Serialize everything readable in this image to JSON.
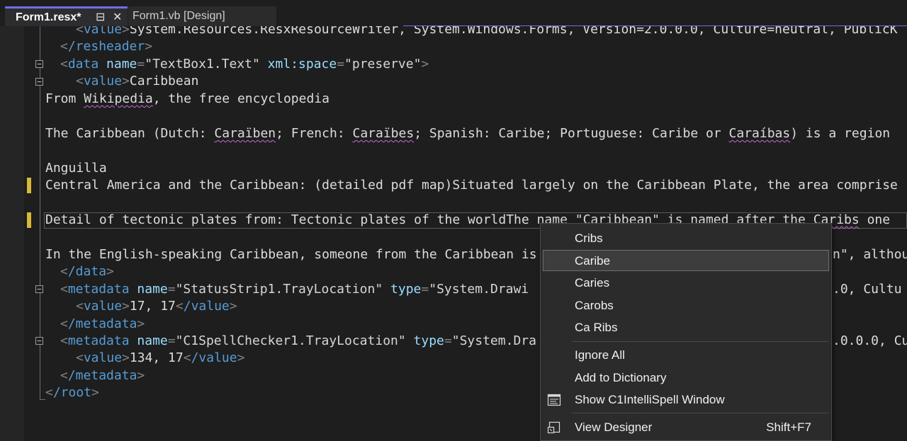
{
  "tabs": [
    {
      "label": "Form1.resx*",
      "active": true
    },
    {
      "label": "Form1.vb [Design]",
      "active": false
    }
  ],
  "tab_icons": {
    "pin": "⊟",
    "close": "✕"
  },
  "colors": {
    "accent": "#6f6fe8",
    "tag": "#569cd6",
    "attribute": "#9cdcfe",
    "change_marker": "#d7ba35"
  },
  "code": {
    "l0": {
      "value_tag": "value",
      "text": "System.Resources.ResxResourceWriter, System.Windows.Forms, Version=2.0.0.0, Culture=neutral, PublicK"
    },
    "l1": {
      "tag": "/resheader"
    },
    "l2": {
      "tag": "data",
      "attr_name": "name",
      "name_val": "\"TextBox1.Text\"",
      "attr_space": "xml:space",
      "space_val": "\"preserve\""
    },
    "l3": {
      "tag": "value",
      "text": "Caribbean"
    },
    "l4": {
      "pre": "From ",
      "squig": "Wikipedia",
      "post": ", the free encyclopedia"
    },
    "l6": {
      "p1": "The Caribbean (Dutch: ",
      "s1": "Caraïben",
      "p2": "; French: ",
      "s2": "Caraïbes",
      "p3": "; Spanish: Caribe; Portuguese: Caribe or ",
      "s3": "Caraíbas",
      "p4": ") is a region"
    },
    "l8": {
      "text": "Anguilla"
    },
    "l9": {
      "text": "Central America and the Caribbean: (detailed pdf map)Situated largely on the Caribbean Plate, the area comprise"
    },
    "l11": {
      "pre": "Detail of tectonic plates from: Tectonic plates of the worldThe name \"Caribbean\" is named after the ",
      "squig": "Caribs",
      "post": " one"
    },
    "l13": {
      "pre": "In the English-speaking Caribbean, someone from the Caribbean is",
      "post": "n\", althou"
    },
    "l14": {
      "tag": "/data"
    },
    "l15": {
      "tag": "metadata",
      "attr_name": "name",
      "name_val": "\"StatusStrip1.TrayLocation\"",
      "attr_type": "type",
      "type_val_pre": "\"System.Drawi",
      "tail": ".0, Cultu"
    },
    "l16": {
      "tag": "value",
      "text": "17, 17",
      "close_tag": "/value"
    },
    "l17": {
      "tag": "/metadata"
    },
    "l18": {
      "tag": "metadata",
      "attr_name": "name",
      "name_val": "\"C1SpellChecker1.TrayLocation\"",
      "attr_type": "type",
      "type_val_pre": "\"System.Dra",
      "tail": ".0.0.0, Cu"
    },
    "l19": {
      "tag": "value",
      "text": "134, 17",
      "close_tag": "/value"
    },
    "l20": {
      "tag": "/metadata"
    },
    "l21": {
      "tag": "/root"
    }
  },
  "context_menu": {
    "suggestions": [
      "Cribs",
      "Caribe",
      "Caries",
      "Carobs",
      "Ca Ribs"
    ],
    "highlighted": "Caribe",
    "ignore_all": "Ignore All",
    "add_to_dictionary": "Add to Dictionary",
    "show_window": "Show C1IntelliSpell Window",
    "view_designer": "View Designer",
    "view_designer_shortcut": "Shift+F7"
  }
}
